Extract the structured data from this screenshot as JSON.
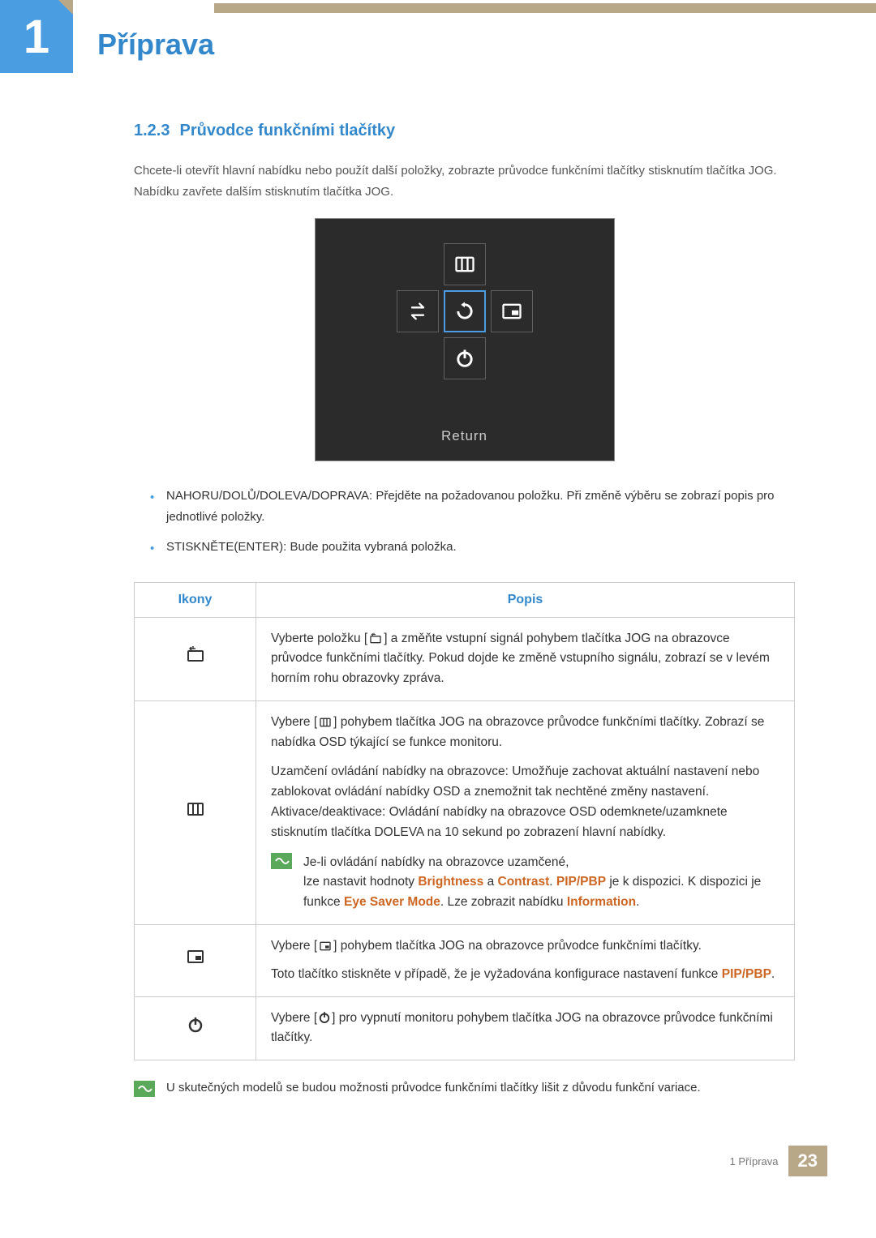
{
  "chapter": {
    "number": "1",
    "title": "Příprava"
  },
  "section": {
    "number": "1.2.3",
    "title": "Průvodce funkčními tlačítky"
  },
  "intro": "Chcete-li otevřít hlavní nabídku nebo použít další položky, zobrazte průvodce funkčními tlačítky stisknutím tlačítka JOG. Nabídku zavřete dalším stisknutím tlačítka JOG.",
  "diagram": {
    "return": "Return"
  },
  "bullets": [
    "NAHORU/DOLŮ/DOLEVA/DOPRAVA: Přejděte na požadovanou položku. Při změně výběru se zobrazí popis pro jednotlivé položky.",
    "STISKNĚTE(ENTER): Bude použita vybraná položka."
  ],
  "table": {
    "headers": {
      "icons": "Ikony",
      "desc": "Popis"
    },
    "rows": {
      "source": {
        "pre": "Vyberte položku [",
        "post": "] a změňte vstupní signál pohybem tlačítka JOG na obrazovce průvodce funkčními tlačítky. Pokud dojde ke změně vstupního signálu, zobrazí se v levém horním rohu obrazovky zpráva."
      },
      "menu": {
        "p1pre": "Vybere [",
        "p1post": "] pohybem tlačítka JOG na obrazovce průvodce funkčními tlačítky. Zobrazí se nabídka OSD týkající se funkce monitoru.",
        "p2": "Uzamčení ovládání nabídky na obrazovce: Umožňuje zachovat aktuální nastavení nebo zablokovat ovládání nabídky OSD a znemožnit tak nechtěné změny nastavení. Aktivace/deaktivace: Ovládání nabídky na obrazovce OSD odemknete/uzamknete stisknutím tlačítka DOLEVA na 10 sekund po zobrazení hlavní nabídky.",
        "note1": "Je-li ovládání nabídky na obrazovce uzamčené,",
        "note2a": "lze nastavit hodnoty ",
        "cb": "Brightness",
        "note2b": " a ",
        "cc": "Contrast",
        "note2c": ". ",
        "cp": "PIP/PBP",
        "note2d": " je k dispozici. K dispozici je funkce ",
        "ce": "Eye Saver Mode",
        "note2e": ". Lze zobrazit nabídku ",
        "ci": "Information",
        "note2f": "."
      },
      "pip": {
        "p1pre": "Vybere [",
        "p1post": "] pohybem tlačítka JOG na obrazovce průvodce funkčními tlačítky.",
        "p2a": "Toto tlačítko stiskněte v případě, že je vyžadována konfigurace nastavení funkce ",
        "p2b": "PIP/PBP",
        "p2c": "."
      },
      "power": {
        "pre": "Vybere [",
        "post": "] pro vypnutí monitoru pohybem tlačítka JOG na obrazovce průvodce funkčními tlačítky."
      }
    }
  },
  "bottom_note": "U skutečných modelů se budou možnosti průvodce funkčními tlačítky lišit z důvodu funkční variace.",
  "footer": {
    "chapter": "1 Příprava",
    "page": "23"
  }
}
